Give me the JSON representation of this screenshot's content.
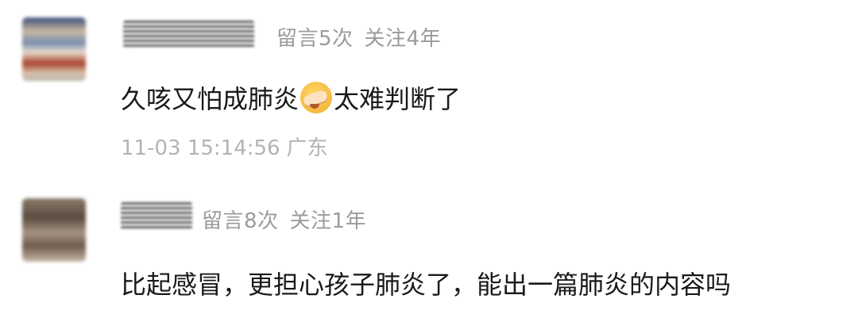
{
  "comments": [
    {
      "meta": {
        "messages": "留言5次",
        "follow": "关注4年"
      },
      "text_before": "久咳又怕成肺炎",
      "emoji": "facepalm-crying-emoji",
      "text_after": "太难判断了",
      "timestamp": "11-03 15:14:56",
      "location": "广东"
    },
    {
      "meta": {
        "messages": "留言8次",
        "follow": "关注1年"
      },
      "text": "比起感冒，更担心孩子肺炎了，能出一篇肺炎的内容吗"
    }
  ]
}
